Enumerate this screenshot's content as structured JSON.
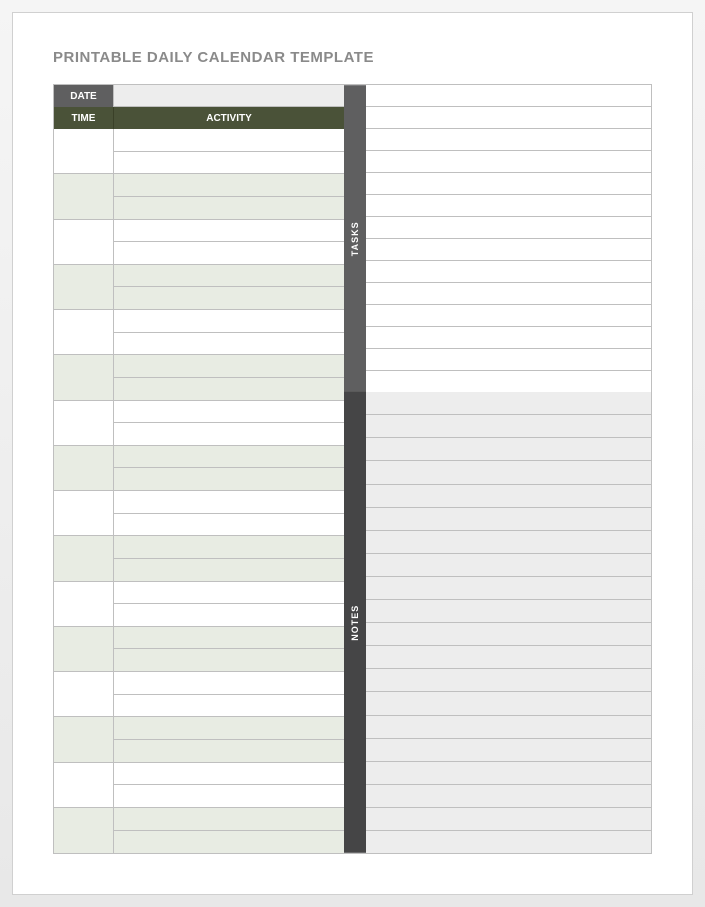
{
  "title": "PRINTABLE DAILY CALENDAR TEMPLATE",
  "headers": {
    "date": "DATE",
    "time": "TIME",
    "activity": "ACTIVITY"
  },
  "spine": {
    "tasks": "TASKS",
    "notes": "NOTES"
  },
  "date_value": "",
  "slots": [
    {
      "time": "",
      "shaded": false,
      "activities": [
        "",
        ""
      ]
    },
    {
      "time": "",
      "shaded": true,
      "activities": [
        "",
        ""
      ]
    },
    {
      "time": "",
      "shaded": false,
      "activities": [
        "",
        ""
      ]
    },
    {
      "time": "",
      "shaded": true,
      "activities": [
        "",
        ""
      ]
    },
    {
      "time": "",
      "shaded": false,
      "activities": [
        "",
        ""
      ]
    },
    {
      "time": "",
      "shaded": true,
      "activities": [
        "",
        ""
      ]
    },
    {
      "time": "",
      "shaded": false,
      "activities": [
        "",
        ""
      ]
    },
    {
      "time": "",
      "shaded": true,
      "activities": [
        "",
        ""
      ]
    },
    {
      "time": "",
      "shaded": false,
      "activities": [
        "",
        ""
      ]
    },
    {
      "time": "",
      "shaded": true,
      "activities": [
        "",
        ""
      ]
    },
    {
      "time": "",
      "shaded": false,
      "activities": [
        "",
        ""
      ]
    },
    {
      "time": "",
      "shaded": true,
      "activities": [
        "",
        ""
      ]
    },
    {
      "time": "",
      "shaded": false,
      "activities": [
        "",
        ""
      ]
    },
    {
      "time": "",
      "shaded": true,
      "activities": [
        "",
        ""
      ]
    },
    {
      "time": "",
      "shaded": false,
      "activities": [
        "",
        ""
      ]
    },
    {
      "time": "",
      "shaded": true,
      "activities": [
        "",
        ""
      ]
    }
  ],
  "tasks_lines": 14,
  "notes_lines": 20
}
